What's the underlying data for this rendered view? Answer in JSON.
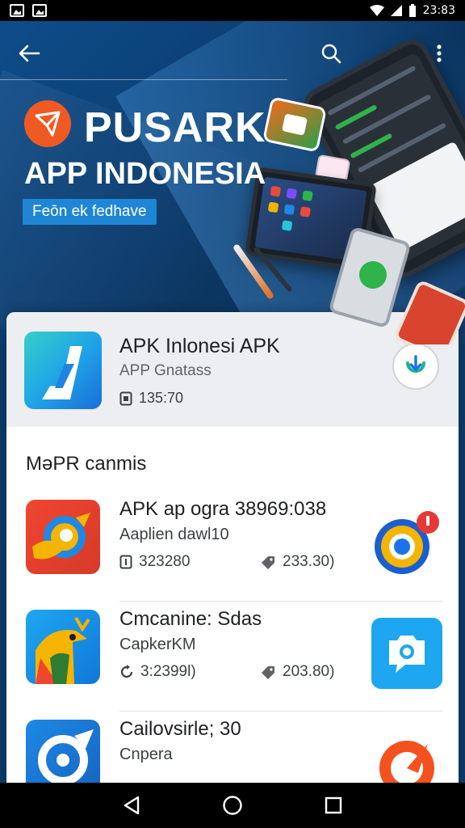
{
  "status_bar": {
    "time": "23:83"
  },
  "hero": {
    "title": "PUSARK",
    "subtitle": "APP INDONESIA",
    "badge": "Feōn ek fedhave"
  },
  "featured_app": {
    "name": "APK Inlonesi APK",
    "publisher": "APP Gnatass",
    "size": "135:70"
  },
  "section": {
    "title": "MəPR canmis"
  },
  "apps": [
    {
      "name": "APK ap ogra 38969:038",
      "subtitle": "Aaplien dawl10",
      "meta1": "323280",
      "meta2": "233.30)"
    },
    {
      "name": "Cmcanine: Sdas",
      "subtitle": "CapkerKM",
      "meta1": "3:2399l)",
      "meta2": "203.80)"
    },
    {
      "name": "Cailovsirle; 30",
      "subtitle": "Cnpera",
      "meta1": "",
      "meta2": ""
    }
  ],
  "colors": {
    "accent": "#1f86d6",
    "hero_logo": "#ef5a24",
    "sheet_bg": "#ffffff",
    "featured_bg": "#eceef1"
  },
  "icons": {
    "back": "arrow-left-icon",
    "search": "search-icon",
    "more": "more-vertical-icon",
    "nav_back": "triangle-back-icon",
    "nav_home": "circle-home-icon",
    "nav_recents": "square-recents-icon"
  }
}
